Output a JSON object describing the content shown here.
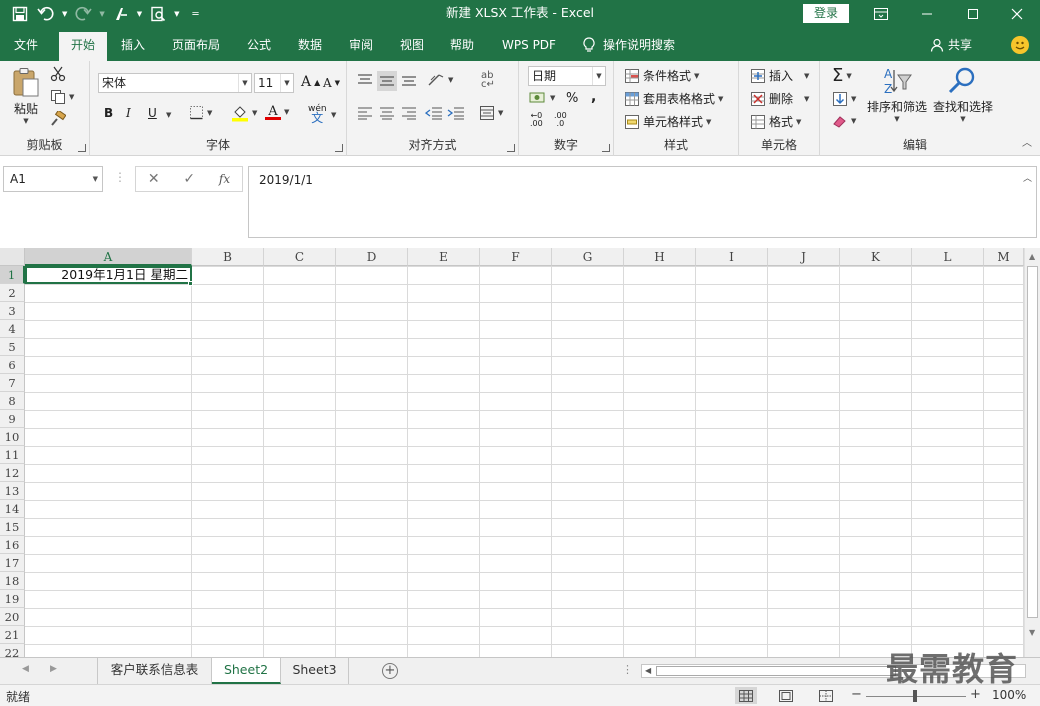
{
  "window": {
    "title": "新建 XLSX 工作表 - Excel",
    "login_label": "登录"
  },
  "tabs": [
    "文件",
    "开始",
    "插入",
    "页面布局",
    "公式",
    "数据",
    "审阅",
    "视图",
    "帮助",
    "WPS PDF"
  ],
  "active_tab": "开始",
  "tellme_label": "操作说明搜索",
  "share_label": "共享",
  "ribbon": {
    "clipboard": {
      "label": "剪贴板",
      "paste_label": "粘贴"
    },
    "font": {
      "label": "字体",
      "font_name": "宋体",
      "font_size": "11",
      "bold": "B",
      "italic": "I",
      "underline": "U",
      "grow": "A",
      "shrink": "A",
      "font_color_letter": "A",
      "wen_label": "wén"
    },
    "alignment": {
      "label": "对齐方式"
    },
    "number": {
      "label": "数字",
      "format": "日期",
      "percent": "%",
      "comma": ",",
      "inc_decimal": ".00",
      "dec_decimal": ".0"
    },
    "styles": {
      "label": "样式",
      "conditional": "条件格式",
      "table_format": "套用表格格式",
      "cell_styles": "单元格样式"
    },
    "cells": {
      "label": "单元格",
      "insert": "插入",
      "delete": "删除",
      "format": "格式"
    },
    "editing": {
      "label": "编辑",
      "sort_filter": "排序和筛选",
      "find_select": "查找和选择"
    }
  },
  "formula_bar": {
    "name_box": "A1",
    "fx_label": "fx",
    "value": "2019/1/1"
  },
  "grid": {
    "columns": [
      "A",
      "B",
      "C",
      "D",
      "E",
      "F",
      "G",
      "H",
      "I",
      "J",
      "K",
      "L",
      "M"
    ],
    "rows": [
      "1",
      "2",
      "3",
      "4",
      "5",
      "6",
      "7",
      "8",
      "9",
      "10",
      "11",
      "12",
      "13",
      "14",
      "15",
      "16",
      "17",
      "18",
      "19",
      "20",
      "21",
      "22"
    ],
    "selected_cell": "A1",
    "a1_display": "2019年1月1日 星期二"
  },
  "sheets": [
    {
      "name": "客户联系信息表"
    },
    {
      "name": "Sheet2"
    },
    {
      "name": "Sheet3"
    }
  ],
  "active_sheet": "Sheet2",
  "status": {
    "ready": "就绪",
    "zoom": "100%",
    "zoom_minus": "−",
    "zoom_plus": "+"
  },
  "watermark": "最需教育",
  "colors": {
    "excel_green": "#217346",
    "ribbon_bg": "#f3f3f3"
  }
}
